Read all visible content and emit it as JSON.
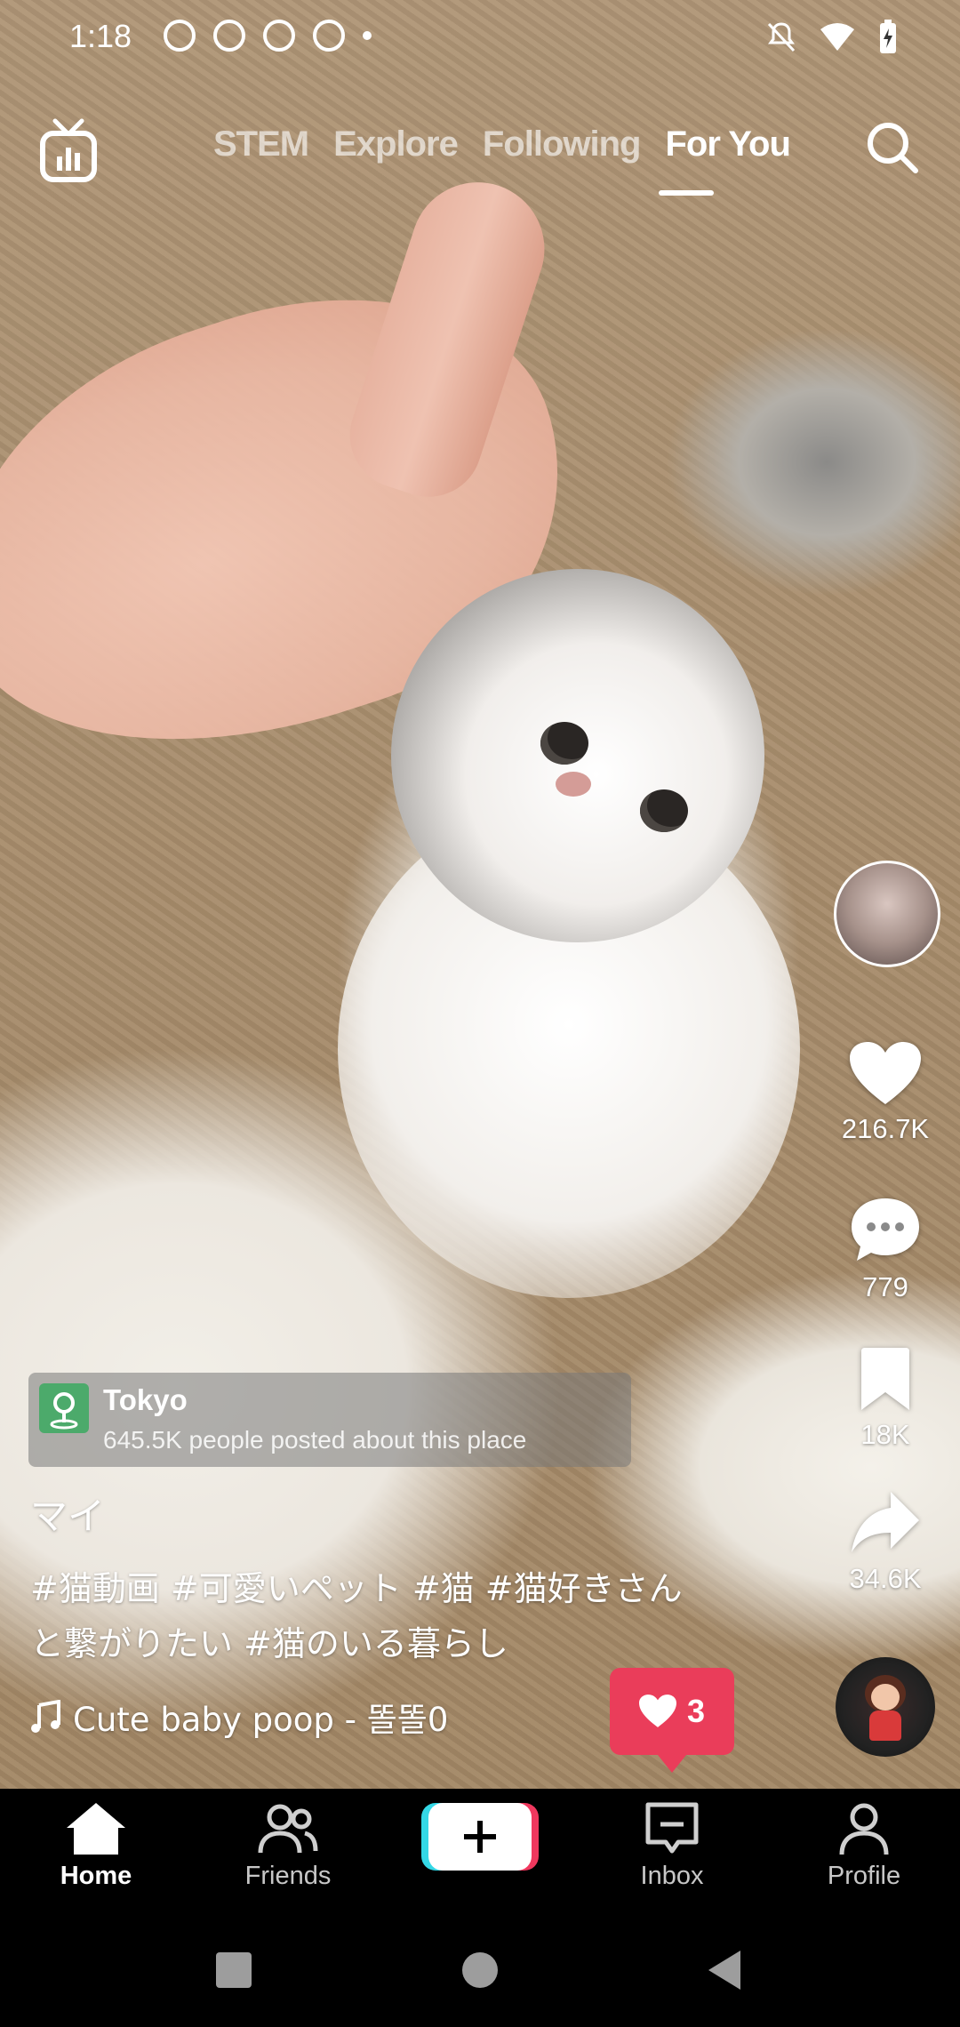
{
  "status_bar": {
    "time": "1:18",
    "icons": [
      "threads-icon",
      "record-icon",
      "pinterest-icon",
      "pinterest-icon",
      "dot-icon"
    ],
    "right_icons": [
      "mute-bell-icon",
      "wifi-icon",
      "battery-charging-icon"
    ]
  },
  "top_nav": {
    "live_icon": "tv-live-icon",
    "tabs": [
      {
        "label": "STEM",
        "active": false
      },
      {
        "label": "Explore",
        "active": false
      },
      {
        "label": "Following",
        "active": false
      },
      {
        "label": "For You",
        "active": true
      }
    ],
    "search_icon": "search-icon"
  },
  "rail": {
    "likes": "216.7K",
    "comments": "779",
    "saves": "18K",
    "shares": "34.6K"
  },
  "location": {
    "name": "Tokyo",
    "description": "645.5K people posted about this place"
  },
  "post": {
    "author": "マイ",
    "caption_line1": "#猫動画 #可愛いペット #猫 #猫好きさん",
    "caption_line2": "と繋がりたい #猫のいる暮らし",
    "sound": "Cute baby poop - 똘똘0"
  },
  "like_popup": {
    "count": "3"
  },
  "bottom_nav": {
    "home": "Home",
    "friends": "Friends",
    "inbox": "Inbox",
    "profile": "Profile"
  },
  "colors": {
    "accent_red": "#ea3d5a",
    "cyan": "#34d8e6",
    "pink": "#f0385e"
  }
}
